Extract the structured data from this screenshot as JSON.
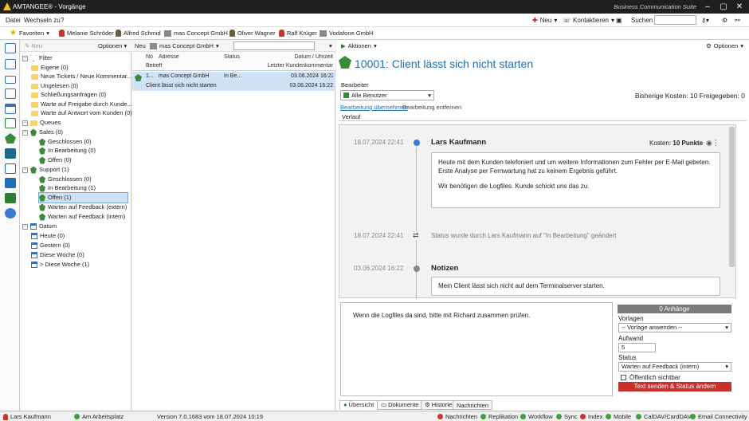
{
  "window": {
    "title": "AMTANGEE® - Vorgänge",
    "suite": "Business Communication Suite",
    "min": "–",
    "max": "▢",
    "close": "✕"
  },
  "menu": {
    "datei": "Datei",
    "wechseln": "Wechseln zu",
    "help": "?",
    "neu": "Neu",
    "kontaktieren": "Kontaktieren",
    "suchen": "Suchen",
    "search_value": ""
  },
  "favorites": {
    "label": "Favoriten",
    "items": [
      "Melanie Schröder",
      "Alfred Schmid",
      "mas Concept GmbH",
      "Oliver Wagner",
      "Ralf Krüger",
      "Vodafone GmbH"
    ]
  },
  "tree_toolbar": {
    "neu": "Neu",
    "optionen": "Optionen"
  },
  "tree": {
    "filter": "Filter",
    "eigene": "Eigene (0)",
    "neue": "Neue Tickets / Neue Kommentar...",
    "ungelesen": "Ungelesen (0)",
    "schliessung": "Schließungsanfragen (0)",
    "warte_freigabe": "Warte auf Freigabe durch Kunde...",
    "warte_antwort": "Warte auf Antwort vom Kunden (0)",
    "queues": "Queues",
    "sales": "Sales (0)",
    "sales_geschlossen": "Geschlossen (0)",
    "sales_bearbeitung": "In Bearbeitung (0)",
    "sales_offen": "Offen (0)",
    "support": "Support (1)",
    "support_geschlossen": "Geschlossen (0)",
    "support_bearbeitung": "In Bearbeitung (1)",
    "support_offen": "Offen (1)",
    "support_extern": "Warten auf Feedback (extern) ...",
    "support_intern": "Warten auf Feedback (intern) ...",
    "datum": "Datum",
    "heute": "Heute (0)",
    "gestern": "Gestern (0)",
    "diese_woche": "Diese Woche (0)",
    "gt_diese_woche": "> Diese Woche (1)"
  },
  "list_toolbar": {
    "neu": "Neu",
    "company": "mas Concept GmbH",
    "filter_value": ""
  },
  "list": {
    "h_no": "No",
    "h_adresse": "Adresse",
    "h_status": "Status",
    "h_datum": "Datum / Uhrzeit",
    "h_betreff": "Betreff",
    "h_letzter": "Letzter Kundenkommentar",
    "row_no": "1...",
    "row_adresse": "mas Concept GmbH",
    "row_status": "In Be...",
    "row_datum": "03.06.2024 16:22",
    "row_betreff": "Client lässt sich nicht starten",
    "row_letzter": "03.06.2024 16:22"
  },
  "detail": {
    "aktionen": "Aktionen",
    "optionen": "Optionen",
    "title": "10001: Client lässt sich nicht starten",
    "bearbeiter_label": "Bearbeiter",
    "bearbeiter_value": "Alle Benutzer",
    "uebernehmen": "Bearbeitung übernehmen",
    "entfernen": "Bearbeitung entfernen",
    "kosten": "Bisherige Kosten: 10 Freigegeben: 0",
    "verlauf": "Verlauf"
  },
  "timeline": {
    "e1_date": "18.07.2024 22:41",
    "e1_author": "Lars Kaufmann",
    "e1_kosten_label": "Kosten:",
    "e1_kosten_value": "10 Punkte",
    "e1_p1": "Heute mit dem Kunden telefoniert und um weitere Informationen zum Fehler per E-Mail gebeten. Erste Analyse per Fernwartung hat zu keinem Ergebnis geführt.",
    "e1_p2": "Wir benötigen die Logfiles. Kunde schickt uns das zu.",
    "e2_date": "18.07.2024 22:41",
    "e2_text": "Status wurde durch Lars Kaufmann auf \"In Bearbeitung\" geändert",
    "e3_date": "03.06.2024 16:22",
    "e3_title": "Notizen",
    "e3_text": "Mein Client lässt sich nicht auf dem Terminalserver starten."
  },
  "compose": {
    "text": "Wenn die Logfiles da sind, bitte mit Richard zusammen prüfen.",
    "anhaenge": "0 Anhänge",
    "vorlagen_label": "Vorlagen",
    "vorlagen_value": "-- Vorlage anwenden --",
    "aufwand_label": "Aufwand",
    "aufwand_value": "5",
    "status_label": "Status",
    "status_value": "Warten auf Feedback (intern)",
    "oeffentlich": "Öffentlich sichtbar",
    "send": "Text senden & Status ändern"
  },
  "tabs": [
    "Übersicht",
    "Dokumente",
    "Historie",
    "Nachrichten"
  ],
  "statusbar": {
    "user": "Lars Kaufmann",
    "place": "Am Arbeitsplatz",
    "version": "Version 7.0.1683 vom 18.07.2024 10:19",
    "services": [
      "Nachrichten",
      "Replikation",
      "Workflow",
      "Sync",
      "Index",
      "Mobile",
      "CalDAV/CardDAV",
      "Email Connectivity"
    ]
  },
  "colors": {
    "accent": "#1f6fb5",
    "send_button": "#c9302c",
    "timeline_dot": "#3a7bd5"
  }
}
